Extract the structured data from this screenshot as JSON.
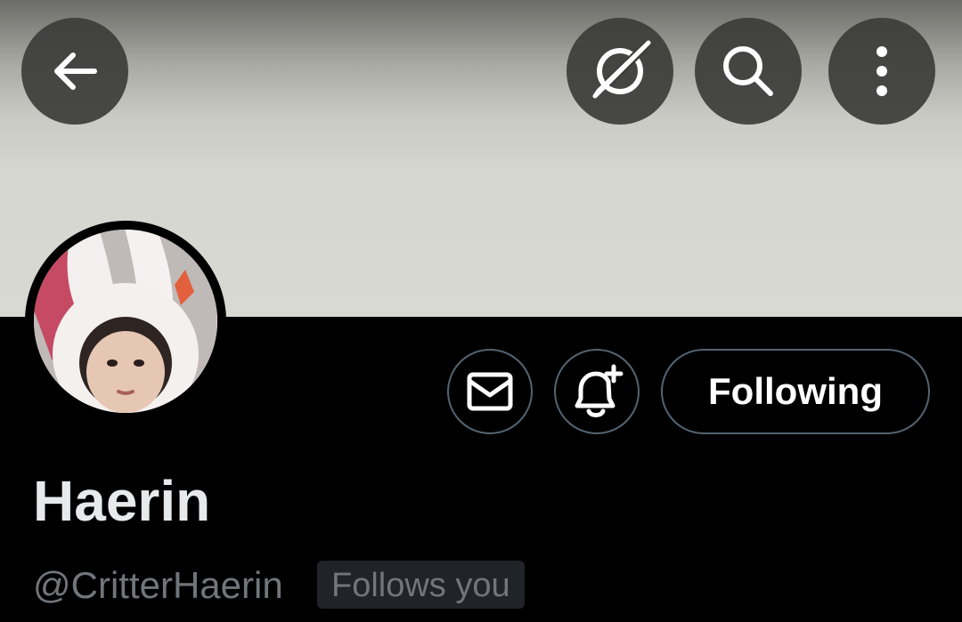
{
  "header": {
    "back_icon": "arrow-left-icon",
    "grok_icon": "grok-icon",
    "search_icon": "search-icon",
    "more_icon": "more-vertical-icon"
  },
  "profile": {
    "avatar": "profile-photo",
    "display_name": "Haerin",
    "handle": "@CritterHaerin",
    "follows_you_label": "Follows you"
  },
  "actions": {
    "message_icon": "mail-icon",
    "notify_icon": "bell-plus-icon",
    "following_label": "Following"
  },
  "colors": {
    "background": "#000000",
    "banner": "#d9d9d3",
    "button_border": "#536471",
    "text_primary": "#e7e9ea",
    "text_secondary": "#71767b"
  }
}
